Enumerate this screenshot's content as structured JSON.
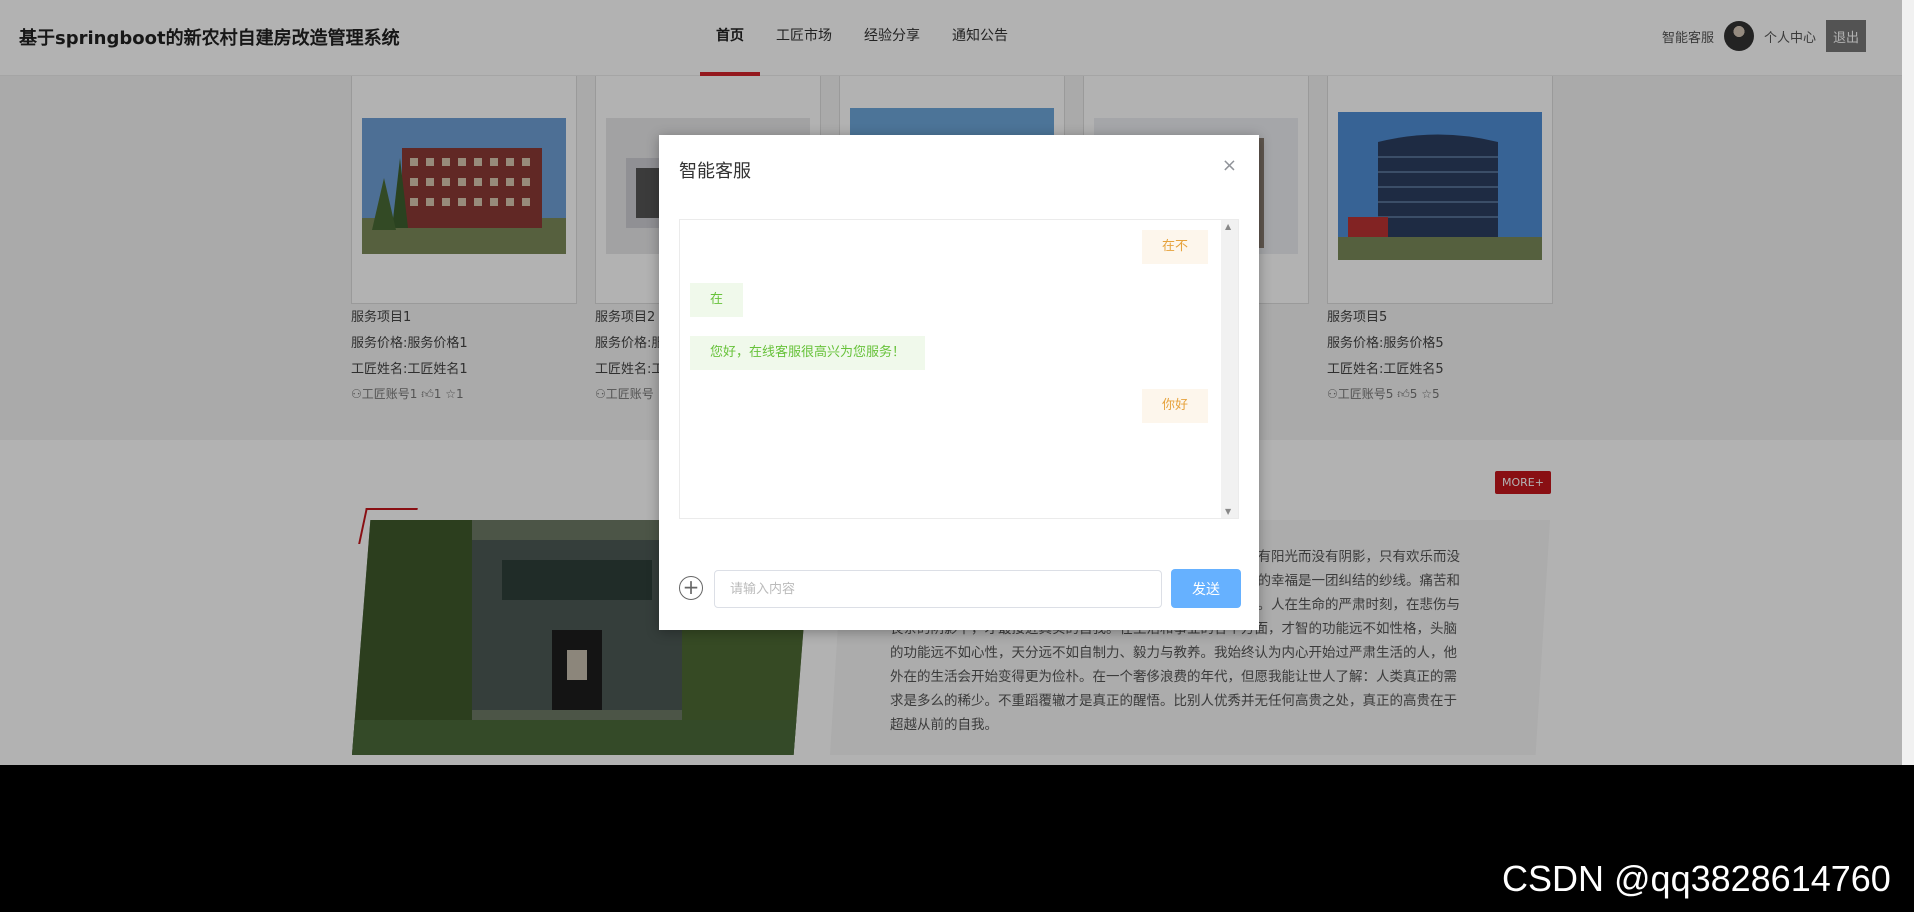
{
  "header": {
    "site_title": "基于springboot的新农村自建房改造管理系统",
    "nav": [
      "首页",
      "工匠市场",
      "经验分享",
      "通知公告"
    ],
    "active_nav": "首页",
    "customer_service": "智能客服",
    "user_center": "个人中心",
    "logout": "退出"
  },
  "services": [
    {
      "name": "服务项目1",
      "price": "服务价格:服务价格1",
      "craftsman": "工匠姓名:工匠姓名1",
      "account": "工匠账号1",
      "likes": "1",
      "favorites": "1"
    },
    {
      "name": "服务项目2",
      "price": "服务价格:服",
      "craftsman": "工匠姓名:工",
      "account": "工匠账号",
      "likes": "",
      "favorites": ""
    },
    {
      "name": "",
      "price": "",
      "craftsman": "",
      "account": "",
      "likes": "",
      "favorites": ""
    },
    {
      "name": "",
      "price": "",
      "craftsman": "",
      "account": "",
      "likes": "",
      "favorites": ""
    },
    {
      "name": "服务项目5",
      "price": "服务价格:服务价格5",
      "craftsman": "工匠姓名:工匠姓名5",
      "account": "工匠账号5",
      "likes": "5",
      "favorites": "5"
    }
  ],
  "experience": {
    "more": "MORE+",
    "lines": [
      "只有阳光而没有阴影，只有欢乐而没",
      "他的幸福是一团纠结的纱线。痛苦和",
      "爱。人在生命的严肃时刻，在悲伤与",
      "丧亲的阴影下，才最接近真实的自我。在生活和事业的各个方面，才智的功能远不如性格，头脑",
      "的功能远不如心性，天分远不如自制力、毅力与教养。我始终认为内心开始过严肃生活的人，他",
      "外在的生活会开始变得更为俭朴。在一个奢侈浪费的年代，但愿我能让世人了解：人类真正的需",
      "求是多么的稀少。不重蹈覆辙才是真正的醒悟。比别人优秀并无任何高贵之处，真正的高贵在于",
      "超越从前的自我。"
    ]
  },
  "dialog": {
    "title": "智能客服",
    "close": "×",
    "messages": [
      {
        "from": "me",
        "text": "在不"
      },
      {
        "from": "bot",
        "text": "在"
      },
      {
        "from": "bot",
        "text": "您好，在线客服很高兴为您服务！"
      },
      {
        "from": "me",
        "text": "你好"
      }
    ],
    "input_placeholder": "请输入内容",
    "send": "发送"
  },
  "watermark": "CSDN @qq3828614760"
}
